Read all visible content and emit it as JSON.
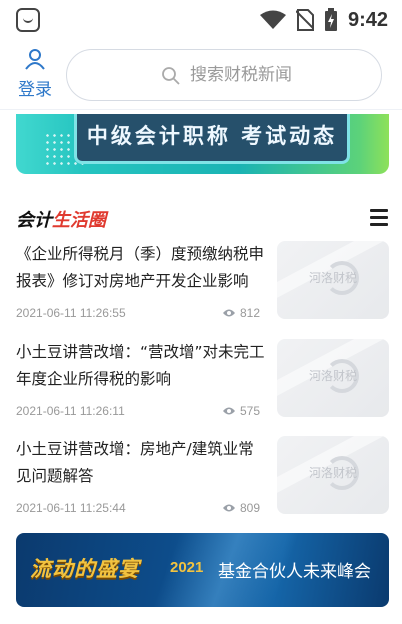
{
  "status_bar": {
    "time": "9:42"
  },
  "header": {
    "login_label": "登录",
    "search_placeholder": "搜索财税新闻"
  },
  "banner_top": {
    "title": "中级会计职称 考试动态"
  },
  "section": {
    "title_part1": "会计",
    "title_part2": "生活圈"
  },
  "articles": [
    {
      "title": "《企业所得税月（季）度预缴纳税申报表》修订对房地产开发企业影响",
      "date": "2021-06-11 11:26:55",
      "views": "812",
      "thumb_text": "河洛财税"
    },
    {
      "title": "小土豆讲营改增：“营改增”对未完工年度企业所得税的影响",
      "date": "2021-06-11 11:26:11",
      "views": "575",
      "thumb_text": "河洛财税"
    },
    {
      "title": "小土豆讲营改增：房地产/建筑业常见问题解答",
      "date": "2021-06-11 11:25:44",
      "views": "809",
      "thumb_text": "河洛财税"
    }
  ],
  "banner_bottom": {
    "left_text": "流动的盛宴",
    "year": "2021",
    "right_text": "基金合伙人未来峰会"
  },
  "colors": {
    "accent": "#2e78c9",
    "section_red": "#e03a2f"
  }
}
